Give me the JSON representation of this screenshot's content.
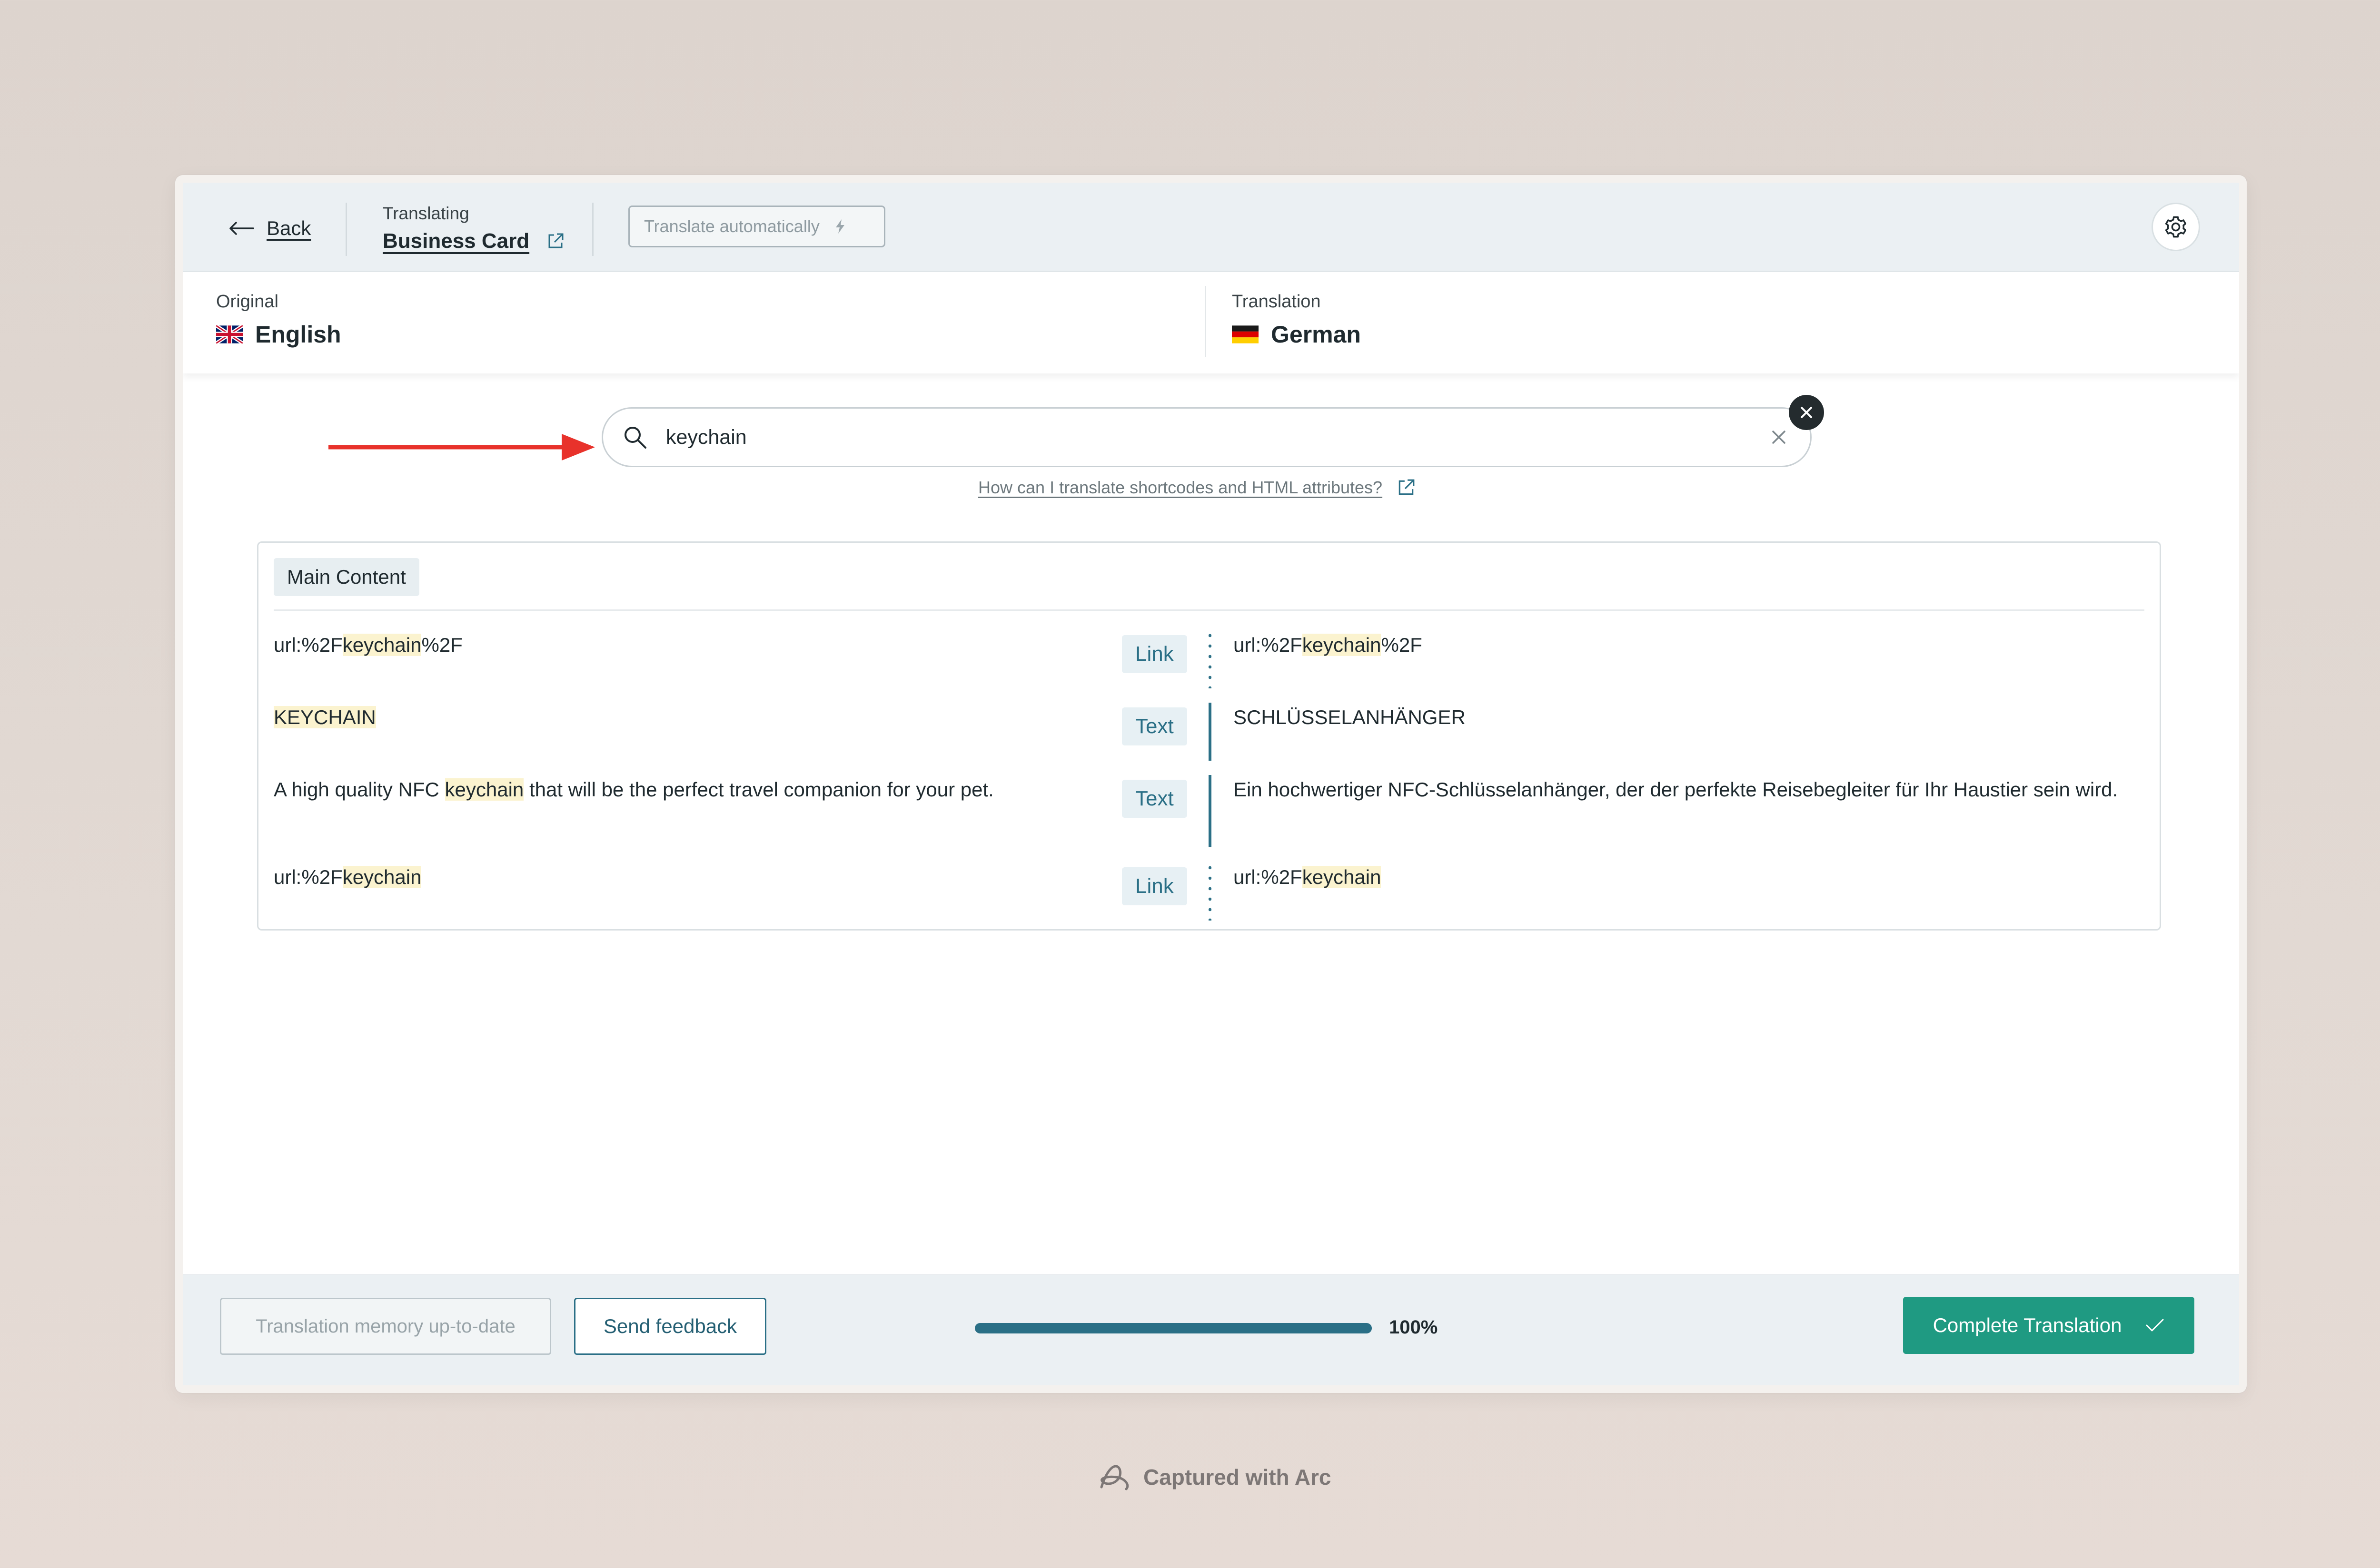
{
  "header": {
    "back_label": "Back",
    "translating_label": "Translating",
    "document_name": "Business Card",
    "auto_translate_label": "Translate automatically"
  },
  "languages": {
    "original_label": "Original",
    "original_language": "English",
    "translation_label": "Translation",
    "translation_language": "German"
  },
  "search": {
    "value": "keychain",
    "help_link": "How can I translate shortcodes and HTML attributes?"
  },
  "content": {
    "section_label": "Main Content",
    "rows": [
      {
        "original_pre": "url:%2F",
        "original_hl": "keychain",
        "original_post": "%2F",
        "type": "Link",
        "translation_pre": "url:%2F",
        "translation_hl": "keychain",
        "translation_post": "%2F"
      },
      {
        "original_pre": "",
        "original_hl": "KEYCHAIN",
        "original_post": "",
        "type": "Text",
        "translation_pre": "SCHLÜSSELANHÄNGER",
        "translation_hl": "",
        "translation_post": ""
      },
      {
        "original_pre": "A high quality NFC ",
        "original_hl": "keychain",
        "original_post": " that will be the perfect travel companion for your pet.",
        "type": "Text",
        "translation_pre": "Ein hochwertiger NFC-Schlüsselanhänger, der der perfekte Reisebegleiter für Ihr Haustier sein wird.",
        "translation_hl": "",
        "translation_post": ""
      },
      {
        "original_pre": "url:%2F",
        "original_hl": "keychain",
        "original_post": "",
        "type": "Link",
        "translation_pre": "url:%2F",
        "translation_hl": "keychain",
        "translation_post": ""
      }
    ]
  },
  "footer": {
    "memory_label": "Translation memory up-to-date",
    "feedback_label": "Send feedback",
    "progress_percent": 100,
    "progress_label": "100%",
    "complete_label": "Complete Translation"
  },
  "watermark": "Captured with Arc",
  "colors": {
    "accent": "#2a6f86",
    "primary_button": "#1f9a82",
    "highlight": "#fbf3cf",
    "annotation_arrow": "#e8322b"
  },
  "icons": [
    "arrow-left-icon",
    "external-link-icon",
    "bolt-icon",
    "gear-icon",
    "uk-flag-icon",
    "de-flag-icon",
    "search-icon",
    "clear-icon",
    "close-icon",
    "check-icon",
    "arc-logo-icon"
  ]
}
